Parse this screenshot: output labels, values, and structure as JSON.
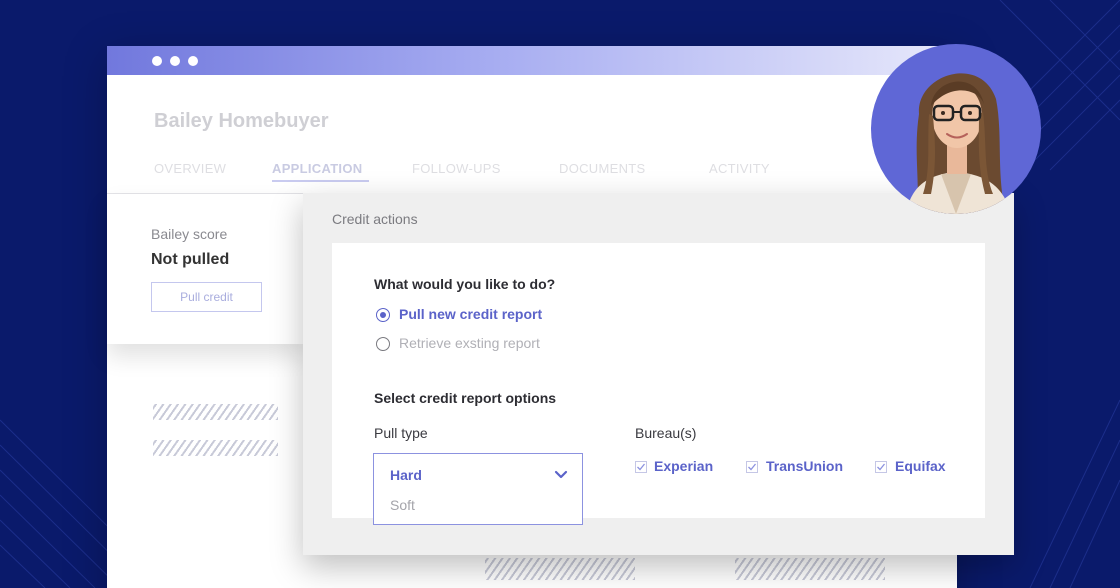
{
  "window": {
    "applicant_name": "Bailey Homebuyer",
    "tabs": [
      {
        "label": "OVERVIEW"
      },
      {
        "label": "APPLICATION",
        "active": true
      },
      {
        "label": "FOLLOW-UPS"
      },
      {
        "label": "DOCUMENTS"
      },
      {
        "label": "ACTIVITY"
      }
    ]
  },
  "score_card": {
    "label": "Bailey score",
    "value": "Not pulled",
    "button": "Pull credit"
  },
  "modal": {
    "title": "Credit actions",
    "question": "What would you like to do?",
    "options": [
      {
        "label": "Pull new credit report",
        "selected": true
      },
      {
        "label": "Retrieve exsting report",
        "selected": false
      }
    ],
    "section_title": "Select credit report options",
    "pull_type": {
      "label": "Pull type",
      "selected": "Hard",
      "options": [
        "Hard",
        "Soft"
      ]
    },
    "bureaus": {
      "label": "Bureau(s)",
      "items": [
        {
          "label": "Experian",
          "checked": true
        },
        {
          "label": "TransUnion",
          "checked": true
        },
        {
          "label": "Equifax",
          "checked": true
        }
      ]
    }
  },
  "colors": {
    "background": "#0a1a6b",
    "accent": "#5b63c9",
    "avatar_bg": "#5f67d6"
  },
  "icons": [
    "chevron-down-icon",
    "checkbox-checked-icon",
    "radio-selected-icon",
    "radio-empty-icon"
  ]
}
